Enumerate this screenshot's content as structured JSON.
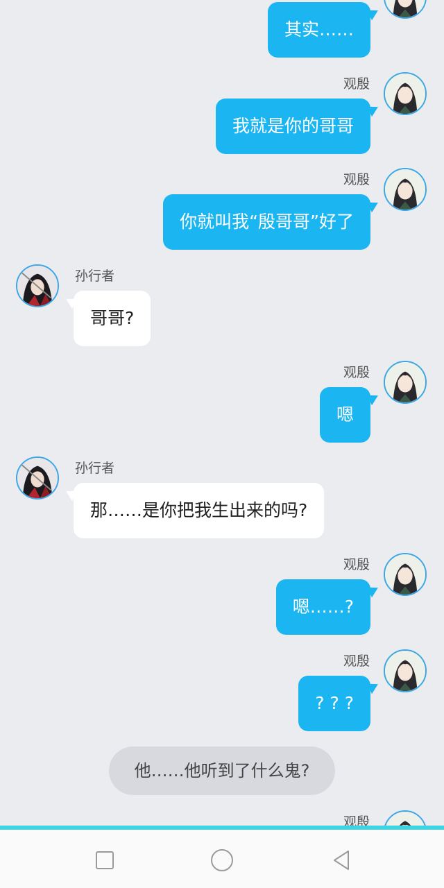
{
  "names": {
    "me": "观殷",
    "other": "孙行者"
  },
  "messages": [
    {
      "side": "right",
      "text": "其实……",
      "show_name": false
    },
    {
      "side": "right",
      "text": "我就是你的哥哥",
      "show_name": true
    },
    {
      "side": "right",
      "text": "你就叫我“殷哥哥”好了",
      "show_name": true
    },
    {
      "side": "left",
      "text": "哥哥?",
      "show_name": true
    },
    {
      "side": "right",
      "text": "嗯",
      "show_name": true
    },
    {
      "side": "left",
      "text": "那……是你把我生出来的吗?",
      "show_name": true
    },
    {
      "side": "right",
      "text": "嗯……?",
      "show_name": true
    },
    {
      "side": "right",
      "text": "? ? ?",
      "show_name": true
    },
    {
      "side": "right",
      "text": "",
      "show_name": true
    }
  ],
  "narration": "他……他听到了什么鬼?",
  "colors": {
    "my_bubble": "#1bb6f2",
    "other_bubble": "#ffffff",
    "background": "#eaecf0",
    "accent_line": "#3fd4e0"
  },
  "navbar": {
    "icons": [
      "square-recents-icon",
      "circle-home-icon",
      "triangle-back-icon"
    ]
  }
}
